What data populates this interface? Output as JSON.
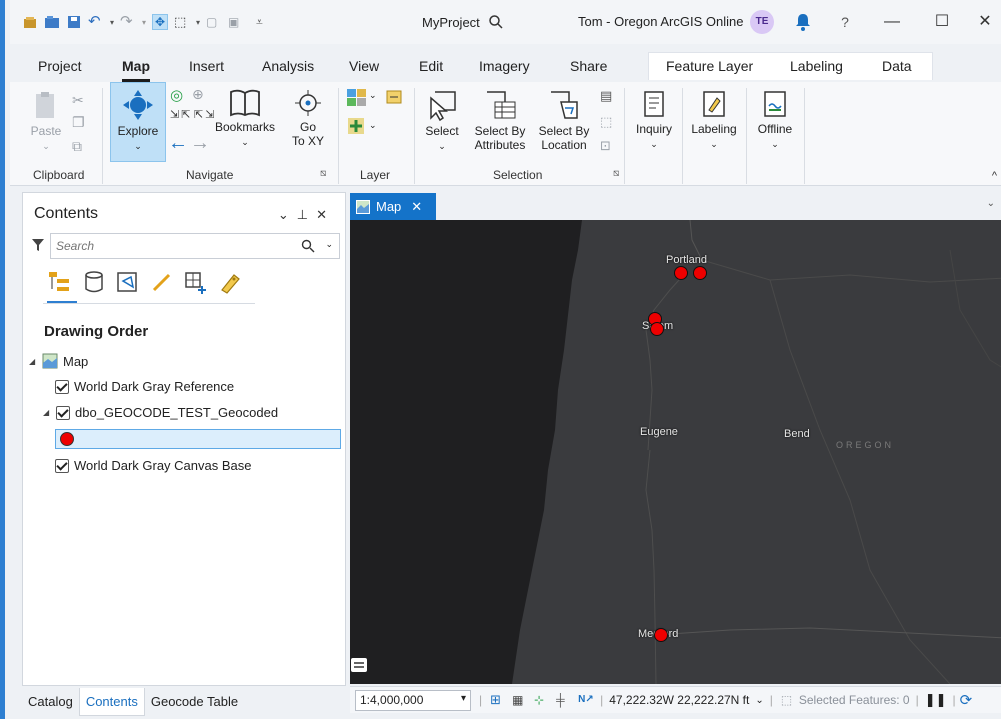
{
  "titlebar": {
    "project_name": "MyProject",
    "user_info": "Tom - Oregon ArcGIS Online",
    "avatar_initials": "TE",
    "help": "?",
    "minimize": "—",
    "maximize": "☐",
    "close": "✕"
  },
  "tabs": [
    "Project",
    "Map",
    "Insert",
    "Analysis",
    "View",
    "Edit",
    "Imagery",
    "Share",
    "Feature Layer",
    "Labeling",
    "Data"
  ],
  "ribbon": {
    "clipboard": {
      "label": "Clipboard",
      "paste": "Paste"
    },
    "navigate": {
      "label": "Navigate",
      "explore": "Explore",
      "bookmarks": "Bookmarks",
      "goto_line1": "Go",
      "goto_line2": "To XY"
    },
    "layer": {
      "label": "Layer"
    },
    "selection": {
      "label": "Selection",
      "select": "Select",
      "by_attr_line1": "Select By",
      "by_attr_line2": "Attributes",
      "by_loc_line1": "Select By",
      "by_loc_line2": "Location"
    },
    "inquiry": "Inquiry",
    "labeling": "Labeling",
    "offline": "Offline"
  },
  "contents": {
    "title": "Contents",
    "search_placeholder": "Search",
    "section_title": "Drawing Order",
    "layers": {
      "map": "Map",
      "reference": "World Dark Gray Reference",
      "geocoded": "dbo_GEOCODE_TEST_Geocoded",
      "canvas": "World Dark Gray Canvas Base"
    }
  },
  "bottom_tabs": {
    "catalog": "Catalog",
    "contents": "Contents",
    "geocode": "Geocode Table"
  },
  "map": {
    "tab_label": "Map",
    "cities": {
      "portland": "Portland",
      "salem": "Salem",
      "eugene": "Eugene",
      "bend": "Bend",
      "medford": "Medford"
    },
    "state_label": "OREGON",
    "colors": {
      "point": "#ee0000",
      "land": "#3a3b3e",
      "ocean": "#1f1f21",
      "accent": "#1473c9"
    }
  },
  "statusbar": {
    "scale": "1:4,000,000",
    "coords": "47,222.32W 22,222.27N ft",
    "selected": "Selected Features: 0"
  }
}
